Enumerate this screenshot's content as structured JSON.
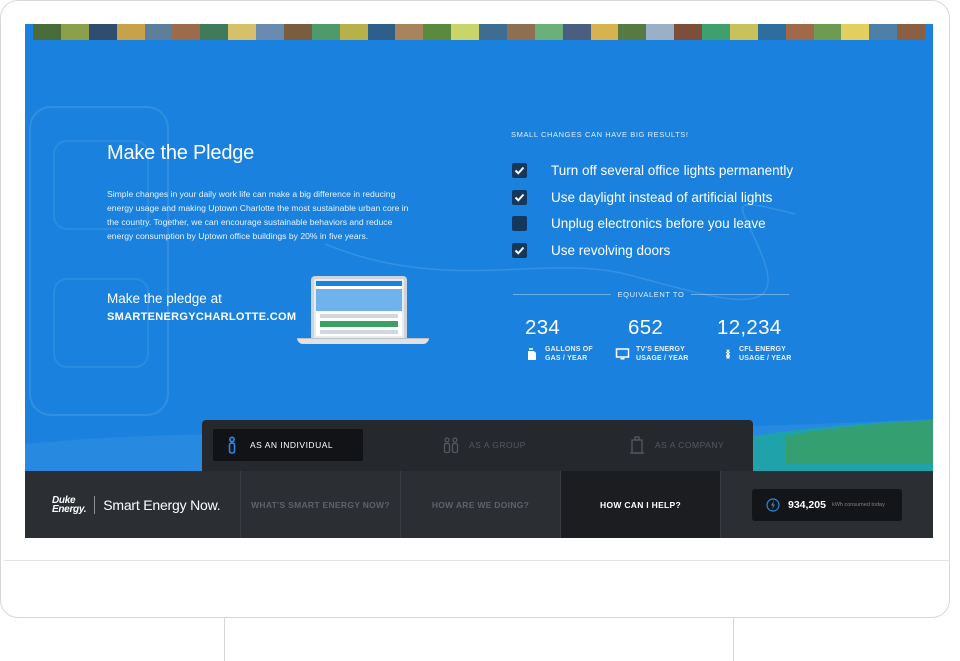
{
  "pledge": {
    "title": "Make the Pledge",
    "body": "Simple changes in your daily work life can make a big difference in reducing energy usage and making Uptown Charlotte the most sustainable urban core in the country. Together, we can encourage sustainable behaviors and reduce energy consumption by Uptown office buildings by 20% in five years.",
    "cta_text": "Make the pledge at",
    "url": "SMARTENERGYCHARLOTTE.COM"
  },
  "checklist": {
    "heading": "SMALL CHANGES CAN HAVE BIG RESULTS!",
    "items": [
      {
        "label": "Turn off several office lights permanently",
        "checked": true
      },
      {
        "label": "Use daylight instead of artificial lights",
        "checked": true
      },
      {
        "label": "Unplug electronics before you leave",
        "checked": false
      },
      {
        "label": "Use revolving doors",
        "checked": true
      }
    ]
  },
  "equivalent": {
    "label": "EQUIVALENT TO",
    "stats": [
      {
        "value": "234",
        "line1": "GALLONS OF",
        "line2": "GAS / YEAR",
        "icon": "gas-can-icon"
      },
      {
        "value": "652",
        "line1": "TV'S ENERGY",
        "line2": "USAGE / YEAR",
        "icon": "tv-icon"
      },
      {
        "value": "12,234",
        "line1": "CFL ENERGY",
        "line2": "USAGE / YEAR",
        "icon": "cfl-bulb-icon"
      }
    ]
  },
  "audience_tabs": {
    "individual": "AS AN INDIVIDUAL",
    "group": "AS A GROUP",
    "company": "AS A COMPANY"
  },
  "nav": {
    "logo": "Duke Energy.",
    "logo_line1": "Duke",
    "logo_line2": "Energy.",
    "brand": "Smart Energy Now.",
    "items": [
      {
        "label": "WHAT'S SMART ENERGY NOW?",
        "active": false
      },
      {
        "label": "HOW ARE WE DOING?",
        "active": false
      },
      {
        "label": "HOW CAN I HELP?",
        "active": true
      }
    ],
    "counter_value": "934,205",
    "counter_label": "kWh consumed today"
  },
  "colors": {
    "screen_blue": "#1a82de",
    "checkbox_navy": "#13375f",
    "nav_dark": "#2b2e33",
    "accent_green": "#3aa063",
    "accent_teal": "#1fa7a0"
  },
  "photo_strip_colors": [
    "#4a6b3a",
    "#8aa04a",
    "#2f4d6e",
    "#c7a24a",
    "#5d7f9c",
    "#9b6b4a",
    "#3f7a5a",
    "#d6c06a",
    "#6a8bb0",
    "#7a5c3e",
    "#4f9a6a",
    "#b8b14a",
    "#2e5f8a",
    "#a7845a",
    "#5b8a3f",
    "#c9d46a",
    "#3d6d91",
    "#8f6f52",
    "#6bb07a",
    "#4a5f7d",
    "#d8b24e",
    "#567a42",
    "#9ab0c6",
    "#7d4f3a",
    "#3fa06e",
    "#c8c25a",
    "#2d6e9e",
    "#a06a4a",
    "#6f9a52",
    "#e2d05e",
    "#4e7fa8",
    "#8a5f42"
  ]
}
